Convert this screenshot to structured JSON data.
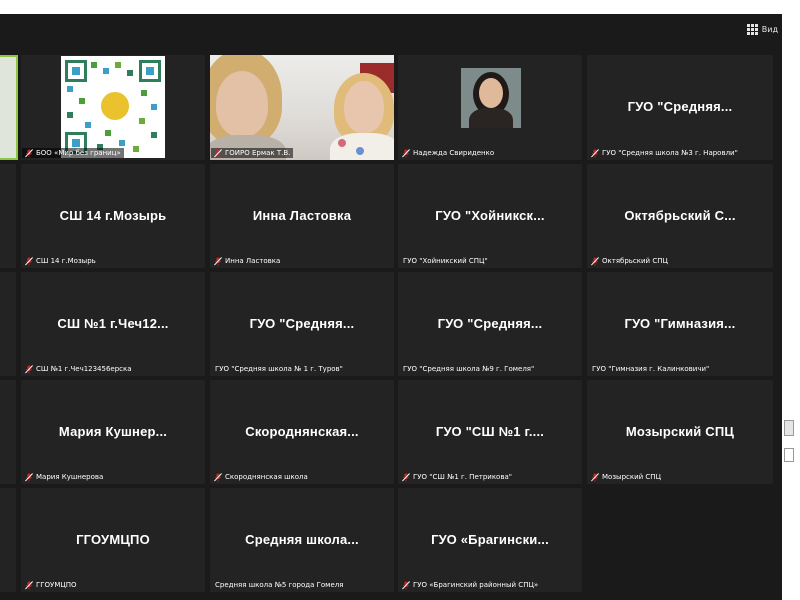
{
  "toolbar": {
    "view_label": "Вид",
    "grid_icon": "grid-icon"
  },
  "colors": {
    "active_border": "#8dc63f",
    "muted_mic": "#c62828",
    "tile_bg": "#232323",
    "window_bg": "#1a1a1a"
  },
  "tiles": [
    {
      "caption": "",
      "type": "edge"
    },
    {
      "caption": "БОО «Мир без границ»",
      "type": "qr"
    },
    {
      "caption": "ГОИРО Ермак Т.В.",
      "type": "video"
    },
    {
      "caption": "Надежда Свириденко",
      "type": "avatar"
    },
    {
      "name": "ГУО \"Средняя...",
      "caption": "ГУО \"Средняя школа №3 г. Наровли\""
    },
    {
      "caption": "",
      "type": "edge"
    },
    {
      "name": "СШ 14 г.Мозырь",
      "caption": "СШ 14 г.Мозырь"
    },
    {
      "name": "Инна Ластовка",
      "caption": "Инна Ластовка"
    },
    {
      "name": "ГУО \"Хойникск...",
      "caption": "ГУО \"Хойникский СПЦ\""
    },
    {
      "name": "Октябрьский С...",
      "caption": "Октябрьский СПЦ"
    },
    {
      "caption": "",
      "type": "edge"
    },
    {
      "name": "СШ №1 г.Чеч12...",
      "caption": "СШ №1 г.Чеч123456ерска"
    },
    {
      "name": "ГУО \"Средняя...",
      "caption": "ГУО \"Средняя школа № 1 г. Туров\""
    },
    {
      "name": "ГУО \"Средняя...",
      "caption": "ГУО \"Средняя школа №9 г. Гомеля\""
    },
    {
      "name": "ГУО \"Гимназия...",
      "caption": "ГУО \"Гимназия г. Калинковичи\""
    },
    {
      "caption": "",
      "type": "edge"
    },
    {
      "name": "Мария Кушнер...",
      "caption": "Мария Кушнерова"
    },
    {
      "name": "Скороднянская...",
      "caption": "Скороднянская школа"
    },
    {
      "name": "ГУО \"СШ №1 г....",
      "caption": "ГУО \"СШ №1 г. Петрикова\""
    },
    {
      "name": "Мозырский СПЦ",
      "caption": "Мозырский СПЦ"
    },
    {
      "caption": "",
      "type": "edge"
    },
    {
      "name": "ГГОУМЦПО",
      "caption": "ГГОУМЦПО"
    },
    {
      "name": "Средняя школа...",
      "caption": "Средняя школа №5 города Гомеля",
      "muted": false
    },
    {
      "name": "ГУО «Брагински...",
      "caption": "ГУО «Брагинский районный СПЦ»"
    }
  ]
}
